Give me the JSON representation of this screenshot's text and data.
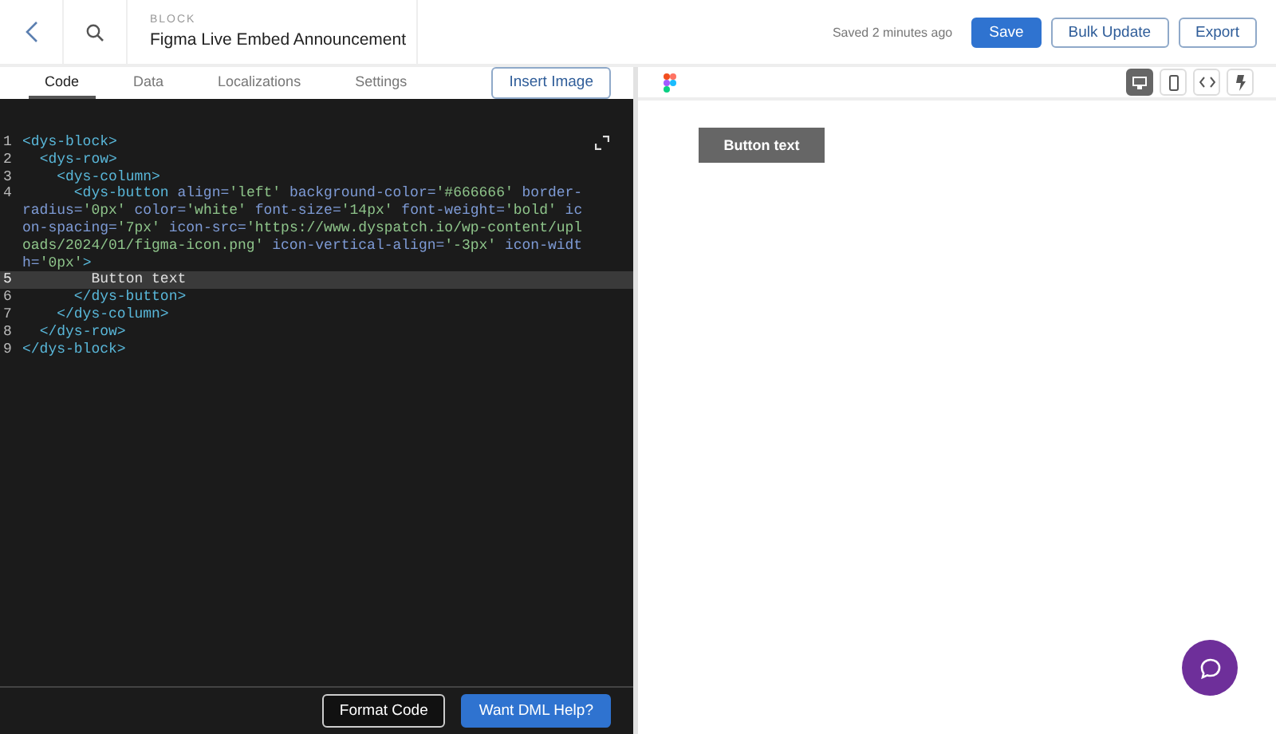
{
  "header": {
    "eyebrow": "BLOCK",
    "title": "Figma Live Embed Announcement",
    "status": "Saved 2 minutes ago",
    "buttons": [
      {
        "label": "Save",
        "kind": "primary"
      },
      {
        "label": "Bulk Update",
        "kind": "outline"
      },
      {
        "label": "Export",
        "kind": "outline"
      }
    ]
  },
  "tabs": [
    {
      "label": "Code",
      "selected": true
    },
    {
      "label": "Data",
      "selected": false
    },
    {
      "label": "Localizations",
      "selected": false
    },
    {
      "label": "Settings",
      "selected": false
    }
  ],
  "insert_button": "Insert Image",
  "preview_modes": [
    {
      "kind": "desktop",
      "selected": true
    },
    {
      "kind": "mobile",
      "selected": false
    },
    {
      "kind": "code",
      "selected": false
    },
    {
      "kind": "bolt",
      "selected": false
    }
  ],
  "editor": {
    "lines": [
      {
        "number": "1",
        "current": false,
        "segments": [
          {
            "kind": "tag",
            "text": "<dys-block>"
          }
        ]
      },
      {
        "number": "2",
        "current": false,
        "segments": [
          {
            "kind": "tag",
            "text": "  <dys-row>"
          }
        ]
      },
      {
        "number": "3",
        "current": false,
        "segments": [
          {
            "kind": "tag",
            "text": "    <dys-column>"
          }
        ]
      },
      {
        "number": "4",
        "current": false,
        "segments": [
          {
            "kind": "tag",
            "text": "      <dys-button"
          },
          {
            "kind": "attr",
            "text": " align="
          },
          {
            "kind": "value",
            "text": "'left'"
          },
          {
            "kind": "attr",
            "text": " background-color="
          },
          {
            "kind": "value",
            "text": "'#666666'"
          },
          {
            "kind": "attr",
            "text": " border-radius="
          },
          {
            "kind": "value",
            "text": "'0px'"
          },
          {
            "kind": "attr",
            "text": " color="
          },
          {
            "kind": "value",
            "text": "'white'"
          },
          {
            "kind": "attr",
            "text": " font-size="
          },
          {
            "kind": "value",
            "text": "'14px'"
          },
          {
            "kind": "attr",
            "text": " font-weight="
          },
          {
            "kind": "value",
            "text": "'bold'"
          },
          {
            "kind": "attr",
            "text": " icon-spacing="
          },
          {
            "kind": "value",
            "text": "'7px'"
          },
          {
            "kind": "attr",
            "text": " icon-src="
          },
          {
            "kind": "value",
            "text": "'https://www.dyspatch.io/wp-content/uploads/2024/01/figma-icon.png'"
          },
          {
            "kind": "attr",
            "text": " icon-vertical-align="
          },
          {
            "kind": "value",
            "text": "'-3px'"
          },
          {
            "kind": "attr",
            "text": " icon-width="
          },
          {
            "kind": "value",
            "text": "'0px'"
          },
          {
            "kind": "tag",
            "text": ">"
          }
        ]
      },
      {
        "number": "5",
        "current": true,
        "segments": [
          {
            "kind": "text",
            "text": "        Button text"
          }
        ]
      },
      {
        "number": "6",
        "current": false,
        "segments": [
          {
            "kind": "tag",
            "text": "      </dys-button>"
          }
        ]
      },
      {
        "number": "7",
        "current": false,
        "segments": [
          {
            "kind": "tag",
            "text": "    </dys-column>"
          }
        ]
      },
      {
        "number": "8",
        "current": false,
        "segments": [
          {
            "kind": "tag",
            "text": "  </dys-row>"
          }
        ]
      },
      {
        "number": "9",
        "current": false,
        "segments": [
          {
            "kind": "tag",
            "text": "</dys-block>"
          }
        ]
      }
    ]
  },
  "footer_buttons": [
    {
      "label": "Format Code",
      "kind": "outline"
    },
    {
      "label": "Want DML Help?",
      "kind": "primary"
    }
  ],
  "preview": {
    "button": "Button text"
  }
}
